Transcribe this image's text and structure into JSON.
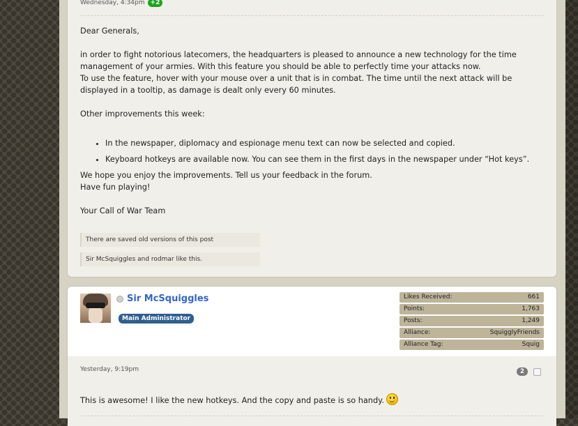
{
  "post1": {
    "date": "Wednesday, 4:34pm",
    "vote_badge": "+2",
    "greeting": "Dear Generals,",
    "para1": "in order to fight notorious latecomers, the headquarters is pleased to announce a new technology for the time management of your armies. With this feature you should be able to perfectly time your attacks now.",
    "para2": "To use the feature, hover with your mouse over a unit that is in combat. The time until the next attack will be displayed in a tooltip, as damage is dealt only every 60 minutes.",
    "other_improvements": "Other improvements this week:",
    "bullets": [
      "In the newspaper, diplomacy and espionage menu text can now be selected and copied.",
      "Keyboard hotkeys are available now. You can see them in the first days in the newspaper under “Hot keys”."
    ],
    "closing1": "We hope you enjoy the improvements. Tell us your feedback in the forum.",
    "closing2": "Have fun playing!",
    "signature": "Your Call of War Team",
    "saved_versions": "There are saved old versions of this post",
    "likes_text": "Sir McSquiggles and rodmar like this."
  },
  "post2": {
    "username": "Sir McSquiggles",
    "role": "Main Administrator",
    "stats": [
      {
        "label": "Likes Received:",
        "value": "661"
      },
      {
        "label": "Points:",
        "value": "1,763"
      },
      {
        "label": "Posts:",
        "value": "1,249"
      },
      {
        "label": "Alliance:",
        "value": "SquigglyFriends"
      },
      {
        "label": "Alliance Tag:",
        "value": "Squig"
      }
    ],
    "date": "Yesterday, 9:19pm",
    "post_number": "2",
    "message": "This is awesome! I like the new hotkeys. And the copy and paste is so handy.",
    "smiley_icon": "smiley-icon"
  },
  "colors": {
    "username": "#3366cc",
    "vote_badge": "#1ca31c",
    "role_badge": "#2f5f8f",
    "stat_bg": "#bdb49a"
  }
}
